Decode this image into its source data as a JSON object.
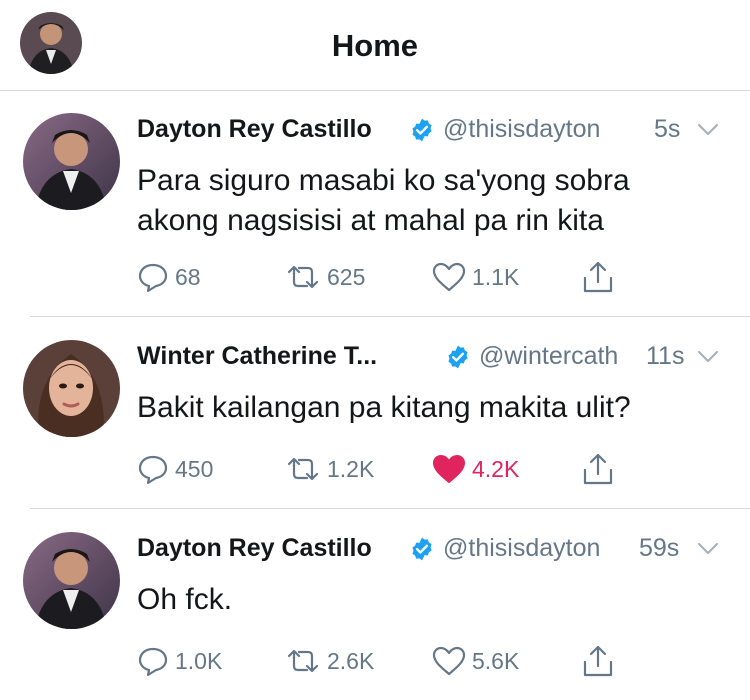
{
  "header": {
    "title": "Home"
  },
  "tweets": [
    {
      "name": "Dayton Rey Castillo",
      "handle": "@thisisdayton",
      "time": "5s",
      "text_lines": [
        "Para siguro masabi ko sa'yong sobra",
        "akong nagsisisi at mahal pa rin kita"
      ],
      "replies": "68",
      "retweets": "625",
      "likes": "1.1K",
      "liked": false
    },
    {
      "name": "Winter Catherine T...",
      "handle": "@wintercath",
      "time": "11s",
      "text_lines": [
        "Bakit kailangan pa kitang makita ulit?"
      ],
      "replies": "450",
      "retweets": "1.2K",
      "likes": "4.2K",
      "liked": true
    },
    {
      "name": "Dayton Rey Castillo",
      "handle": "@thisisdayton",
      "time": "59s",
      "text_lines": [
        "Oh fck."
      ],
      "replies": "1.0K",
      "retweets": "2.6K",
      "likes": "5.6K",
      "liked": false
    }
  ],
  "colors": {
    "verified": "#1da1f2",
    "liked": "#e0245e",
    "secondary_text": "#657786",
    "divider": "#d6dadf"
  },
  "icons": [
    "reply-icon",
    "retweet-icon",
    "like-icon",
    "share-icon",
    "verified-icon",
    "chevron-down-icon"
  ]
}
